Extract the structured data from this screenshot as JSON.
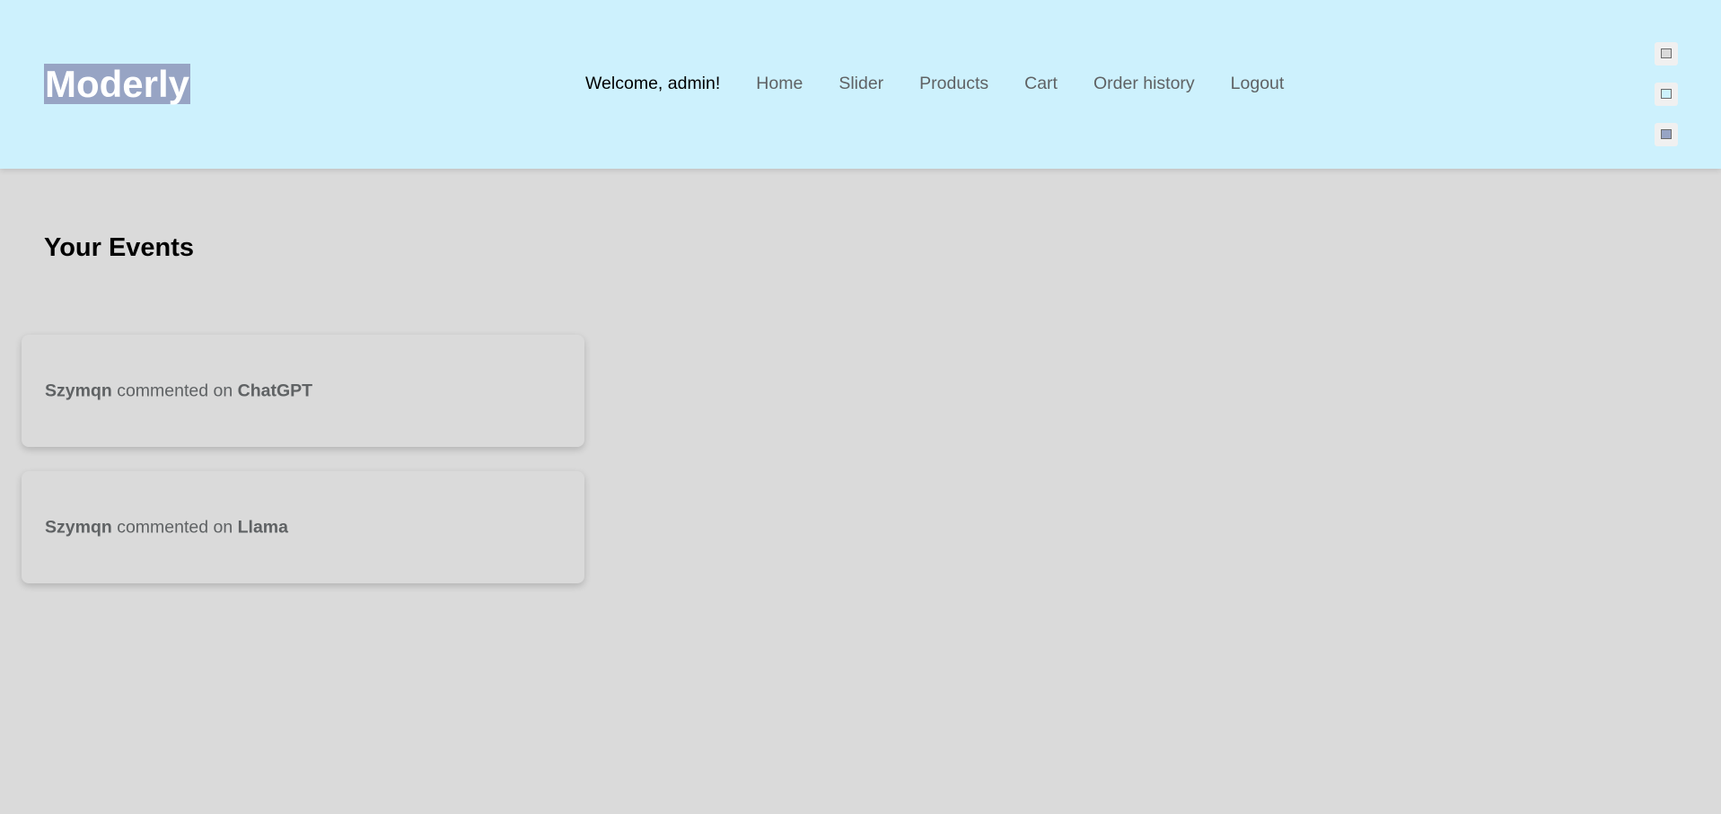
{
  "header": {
    "logo": "Moderly",
    "welcome": "Welcome, admin!",
    "nav": [
      "Home",
      "Slider",
      "Products",
      "Cart",
      "Order history",
      "Logout"
    ],
    "theme_swatches": [
      {
        "name": "gray-theme",
        "color": "#dadada"
      },
      {
        "name": "light-blue-theme",
        "color": "#cdf1fd"
      },
      {
        "name": "slate-blue-theme",
        "color": "#97a4c4"
      }
    ]
  },
  "main": {
    "title": "Your Events",
    "events": [
      {
        "user": "Szymqn",
        "action": "commented on",
        "target": "ChatGPT"
      },
      {
        "user": "Szymqn",
        "action": "commented on",
        "target": "Llama"
      }
    ]
  },
  "colors": {
    "header_bg": "#cdf1fd",
    "page_bg": "#dadada",
    "logo_bg": "#97a4c4",
    "nav_text": "#5f6264"
  }
}
